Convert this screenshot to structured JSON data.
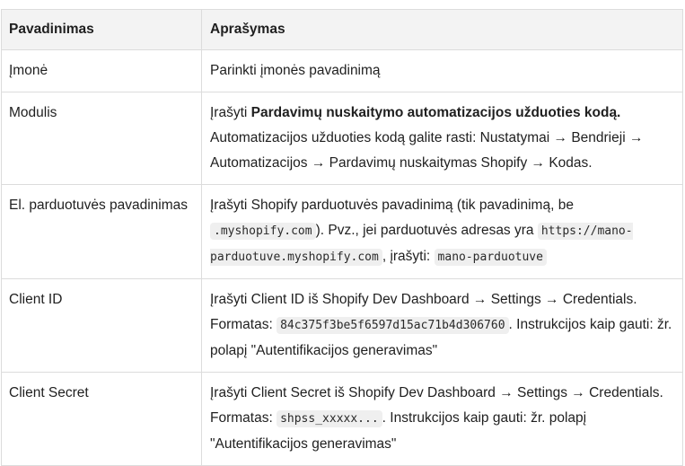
{
  "table": {
    "headers": [
      "Pavadinimas",
      "Aprašymas"
    ],
    "rows": [
      {
        "name": "Įmonė",
        "desc": "Parinkti įmonės pavadinimą"
      },
      {
        "name": "Modulis",
        "desc_prefix": "Įrašyti ",
        "desc_bold": "Pardavimų nuskaitymo automatizacijos užduoties kodą.",
        "desc_suffix": " Automatizacijos užduoties kodą galite rasti: Nustatymai → Bendrieji → Automatizacijos → Pardavimų nuskaitymas Shopify → Kodas."
      },
      {
        "name": "El. parduotuvės pavadinimas",
        "desc_1": "Įrašyti Shopify parduotuvės pavadinimą (tik pavadinimą, be ",
        "code_1": ".myshopify.com",
        "desc_2": "). Pvz., jei parduotuvės adresas yra ",
        "code_2": "https://mano-parduotuve.myshopify.com",
        "desc_3": ", įrašyti: ",
        "code_3": "mano-parduotuve"
      },
      {
        "name": "Client ID",
        "desc_1": "Įrašyti Client ID iš Shopify Dev Dashboard → Settings → Credentials. Formatas: ",
        "code_1": "84c375f3be5f6597d15ac71b4d306760",
        "desc_2": ". Instrukcijos kaip gauti: žr. polapį \"Autentifikacijos generavimas\""
      },
      {
        "name": "Client Secret",
        "desc_1": "Įrašyti Client Secret iš Shopify Dev Dashboard → Settings → Credentials. Formatas: ",
        "code_1": "shpss_xxxxx...",
        "desc_2": ". Instrukcijos kaip gauti: žr. polapį \"Autentifikacijos generavimas\""
      }
    ]
  }
}
